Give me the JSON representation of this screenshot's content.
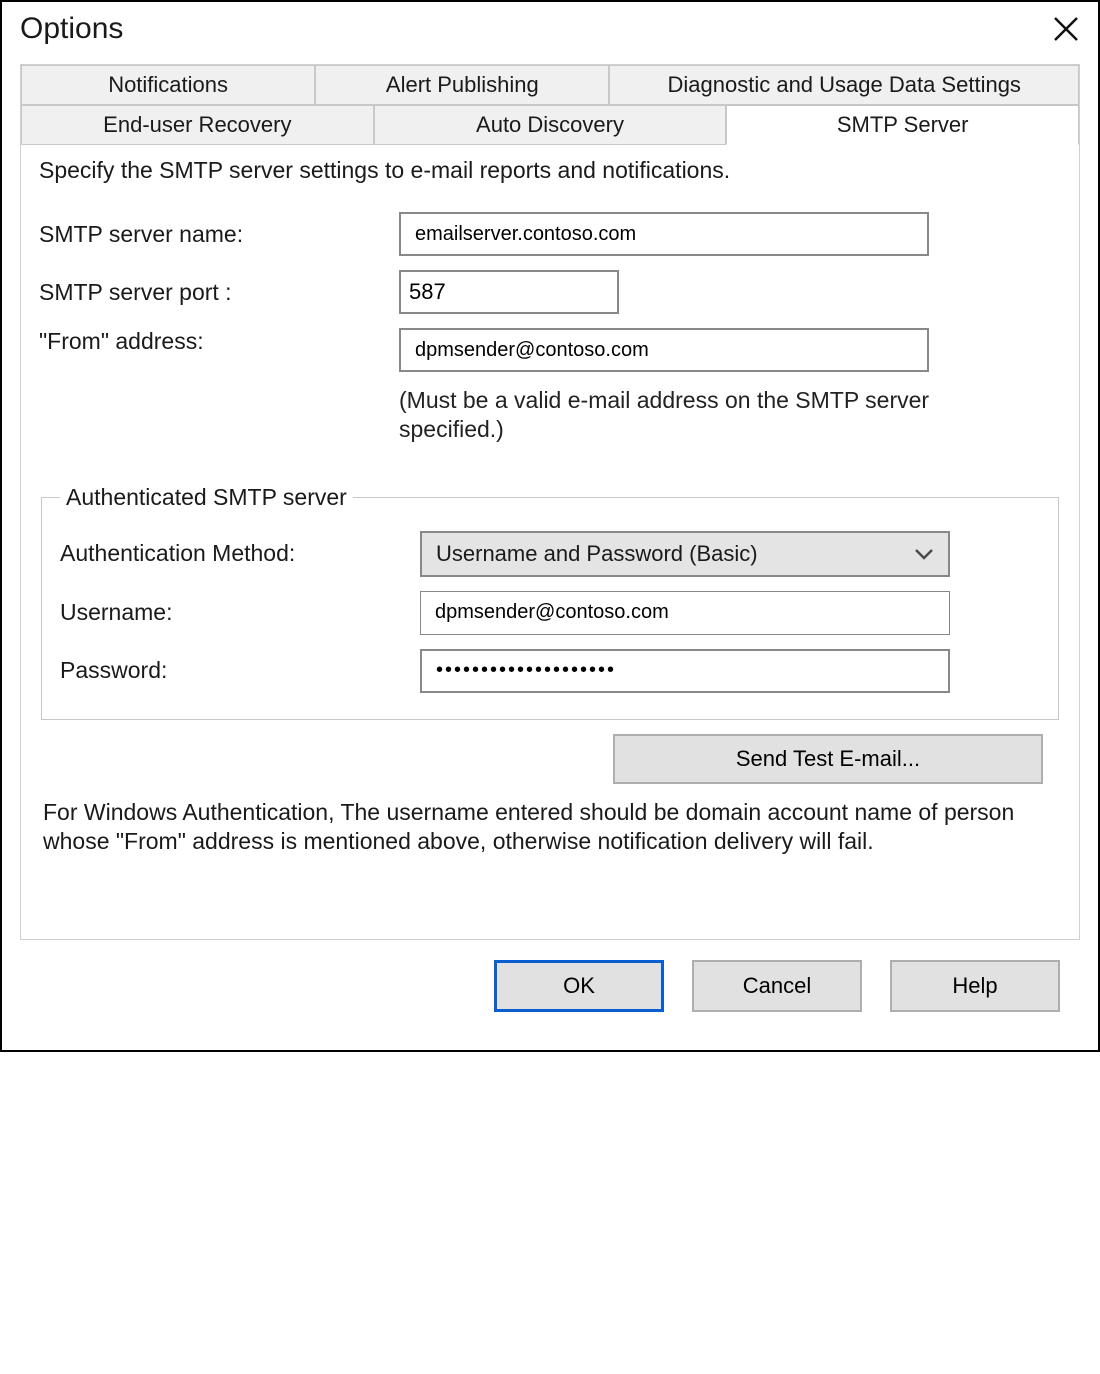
{
  "window": {
    "title": "Options"
  },
  "tabs": {
    "row1": [
      "Notifications",
      "Alert Publishing",
      "Diagnostic and Usage Data Settings"
    ],
    "row2": [
      "End-user Recovery",
      "Auto Discovery",
      "SMTP Server"
    ],
    "active": "SMTP Server"
  },
  "smtp": {
    "intro": "Specify the SMTP server settings to e-mail reports and notifications.",
    "server_name_label": "SMTP server name:",
    "server_name_value": "emailserver.contoso.com",
    "server_port_label": "SMTP server port :",
    "server_port_value": "587",
    "from_label": "\"From\" address:",
    "from_value": "dpmsender@contoso.com",
    "from_hint": "(Must be a valid e-mail address on the SMTP server specified.)"
  },
  "auth_group": {
    "legend": "Authenticated SMTP server",
    "method_label": "Authentication Method:",
    "method_value": "Username and Password (Basic)",
    "username_label": "Username:",
    "username_value": "dpmsender@contoso.com",
    "password_label": "Password:",
    "password_value": "••••••••••••••••••••"
  },
  "send_test_label": "Send Test E-mail...",
  "footer_note": "For Windows Authentication, The username entered should be domain account name of person whose \"From\" address is mentioned above, otherwise notification delivery will fail.",
  "buttons": {
    "ok": "OK",
    "cancel": "Cancel",
    "help": "Help"
  }
}
